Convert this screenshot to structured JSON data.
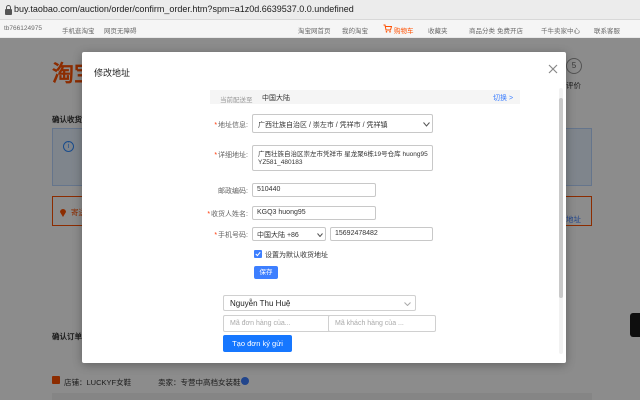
{
  "browser": {
    "url": "buy.taobao.com/auction/order/confirm_order.htm?spm=a1z0d.6639537.0.0.undefined"
  },
  "topnav": {
    "phone": "tb766124975",
    "links": [
      "手机逛淘宝",
      "网页无障碍"
    ],
    "right": [
      "淘宝网首页",
      "我的淘宝",
      "购物车",
      "收藏夹",
      "商品分类",
      "免费开店",
      "千牛卖家中心",
      "联系客服"
    ]
  },
  "background": {
    "logo": "淘宝",
    "confirm_address": "确认收货",
    "send_to": "寄送",
    "circle": "5",
    "review": "评价",
    "address_link": "地址",
    "confirm_order": "确认订单",
    "shop": "店铺：LUCKYF女鞋",
    "seller": "卖家：专营中高档女装鞋"
  },
  "dialog": {
    "title": "修改地址",
    "region_key": "当前配送至",
    "region_value": "中国大陆",
    "region_switch": "切换 >",
    "address_label": "地址信息:",
    "address_select": "广西壮族自治区 / 崇左市 / 凭祥市 / 凭祥镇",
    "detail_label": "详细地址:",
    "detail_value": "广西壮族自治区崇左市凭祥市 星龙聚6栋19号仓库 huong95 YZ581_480183",
    "postcode_label": "邮政编码:",
    "postcode_value": "510440",
    "name_label": "收货人姓名:",
    "name_value": "KGQ3 huong95",
    "phone_label": "手机号码:",
    "phone_region": "中国大陆 +86",
    "phone_value": "15692478482",
    "default_label": "设置为默认收货地址",
    "save_label": "保存"
  },
  "extension": {
    "person": "Nguyễn Thu Huệ",
    "order_placeholder": "Mã đơn hàng của...",
    "customer_placeholder": "Mã khách hàng của ...",
    "create_label": "Tạo đơn ký gửi"
  },
  "colors": {
    "brand": "#ff5000",
    "primary": "#3d7fff",
    "create": "#1677ff"
  }
}
